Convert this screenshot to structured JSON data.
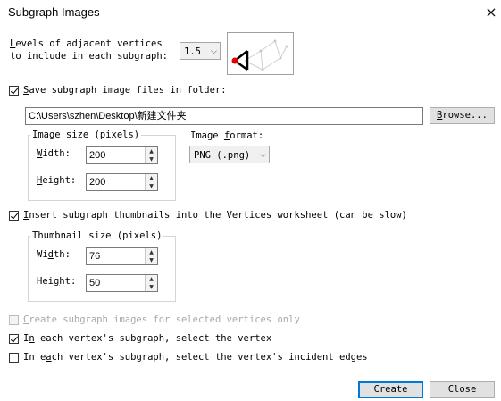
{
  "window": {
    "title": "Subgraph Images"
  },
  "levels": {
    "label_pre": "L",
    "label_rest": "evels of adjacent vertices",
    "label_line2": "to include in each subgraph:",
    "value": "1.5"
  },
  "save": {
    "checked": true,
    "label_pre": "S",
    "label_rest": "ave subgraph image files in folder:",
    "folder": "C:\\Users\\szhen\\Desktop\\新建文件夹",
    "browse_pre": "B",
    "browse_rest": "rowse..."
  },
  "image_size": {
    "legend": "Image size (pixels)",
    "width_pre": "W",
    "width_rest": "idth:",
    "width_value": "200",
    "height_pre": "H",
    "height_rest": "eight:",
    "height_value": "200"
  },
  "image_format": {
    "label_a": "Image ",
    "label_u": "f",
    "label_b": "ormat:",
    "value": "PNG (.png)"
  },
  "thumbnails": {
    "checked": true,
    "label_pre": "I",
    "label_rest": "nsert subgraph thumbnails into the Vertices worksheet (can be slow)",
    "legend": "Thumbnail size (pixels)",
    "width_a": "Wi",
    "width_u": "d",
    "width_b": "th:",
    "width_value": "76",
    "height_a": "Hei",
    "height_u": "g",
    "height_b": "ht:",
    "height_value": "50"
  },
  "selected_only": {
    "checked": false,
    "disabled": true,
    "label_pre": "C",
    "label_rest": "reate subgraph images for selected vertices only"
  },
  "select_vertex": {
    "checked": true,
    "label_a": "I",
    "label_u": "n",
    "label_b": " each vertex's subgraph, select the vertex"
  },
  "select_edges": {
    "checked": false,
    "label_a": "In e",
    "label_u": "a",
    "label_b": "ch vertex's subgraph, select the vertex's incident edges"
  },
  "buttons": {
    "create": "Create",
    "close": "Close"
  },
  "icons": {
    "close": "×",
    "chevron": "⌵",
    "spin_up": "▲",
    "spin_down": "▼"
  },
  "colors": {
    "accent": "#0078d7",
    "vertex_selected": "#e00000"
  }
}
